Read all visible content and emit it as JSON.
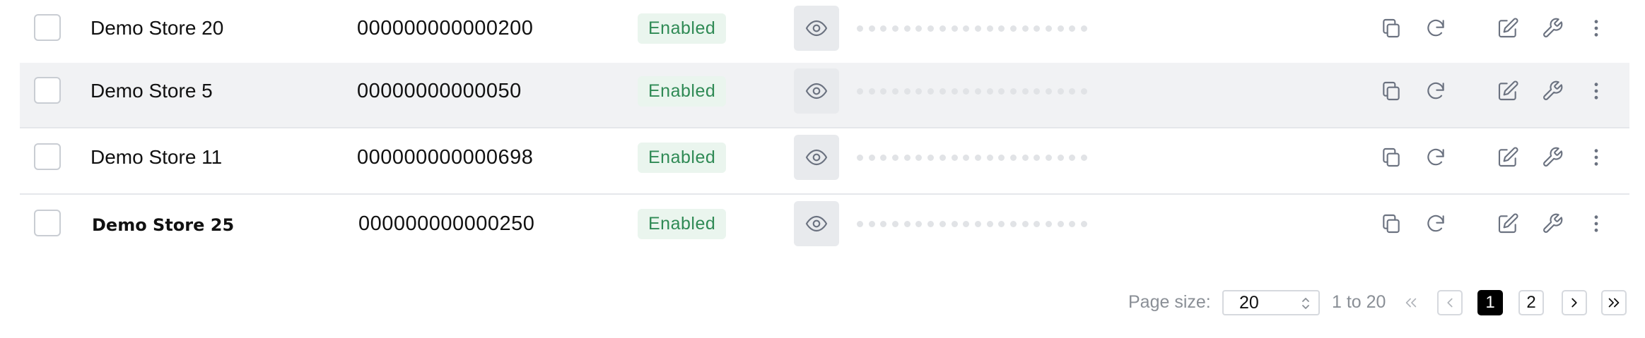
{
  "rows": [
    {
      "name": "Demo Store 20",
      "id": "000000000000200",
      "status": "Enabled"
    },
    {
      "name": "Demo Store 5",
      "id": "00000000000050",
      "status": "Enabled"
    },
    {
      "name": "Demo Store 11",
      "id": "000000000000698",
      "status": "Enabled"
    },
    {
      "name": "Demo Store 25",
      "id": "000000000000250",
      "status": "Enabled"
    }
  ],
  "pagination": {
    "page_size_label": "Page size:",
    "page_size_value": "20",
    "range_text": "1 to 20",
    "pages": [
      "1",
      "2"
    ],
    "current_page": "1"
  },
  "colors": {
    "badge_bg": "#eaf5ee",
    "badge_text": "#2f8a55",
    "row_alt_bg": "#f1f2f4",
    "icon_gray": "#6b7280"
  },
  "icons": {
    "row_actions": [
      "copy-icon",
      "refresh-icon",
      "edit-icon",
      "wrench-icon",
      "more-vertical-icon"
    ],
    "reveal": "eye-icon",
    "pagination": [
      "first-page-icon",
      "prev-page-icon",
      "next-page-icon",
      "last-page-icon"
    ]
  }
}
